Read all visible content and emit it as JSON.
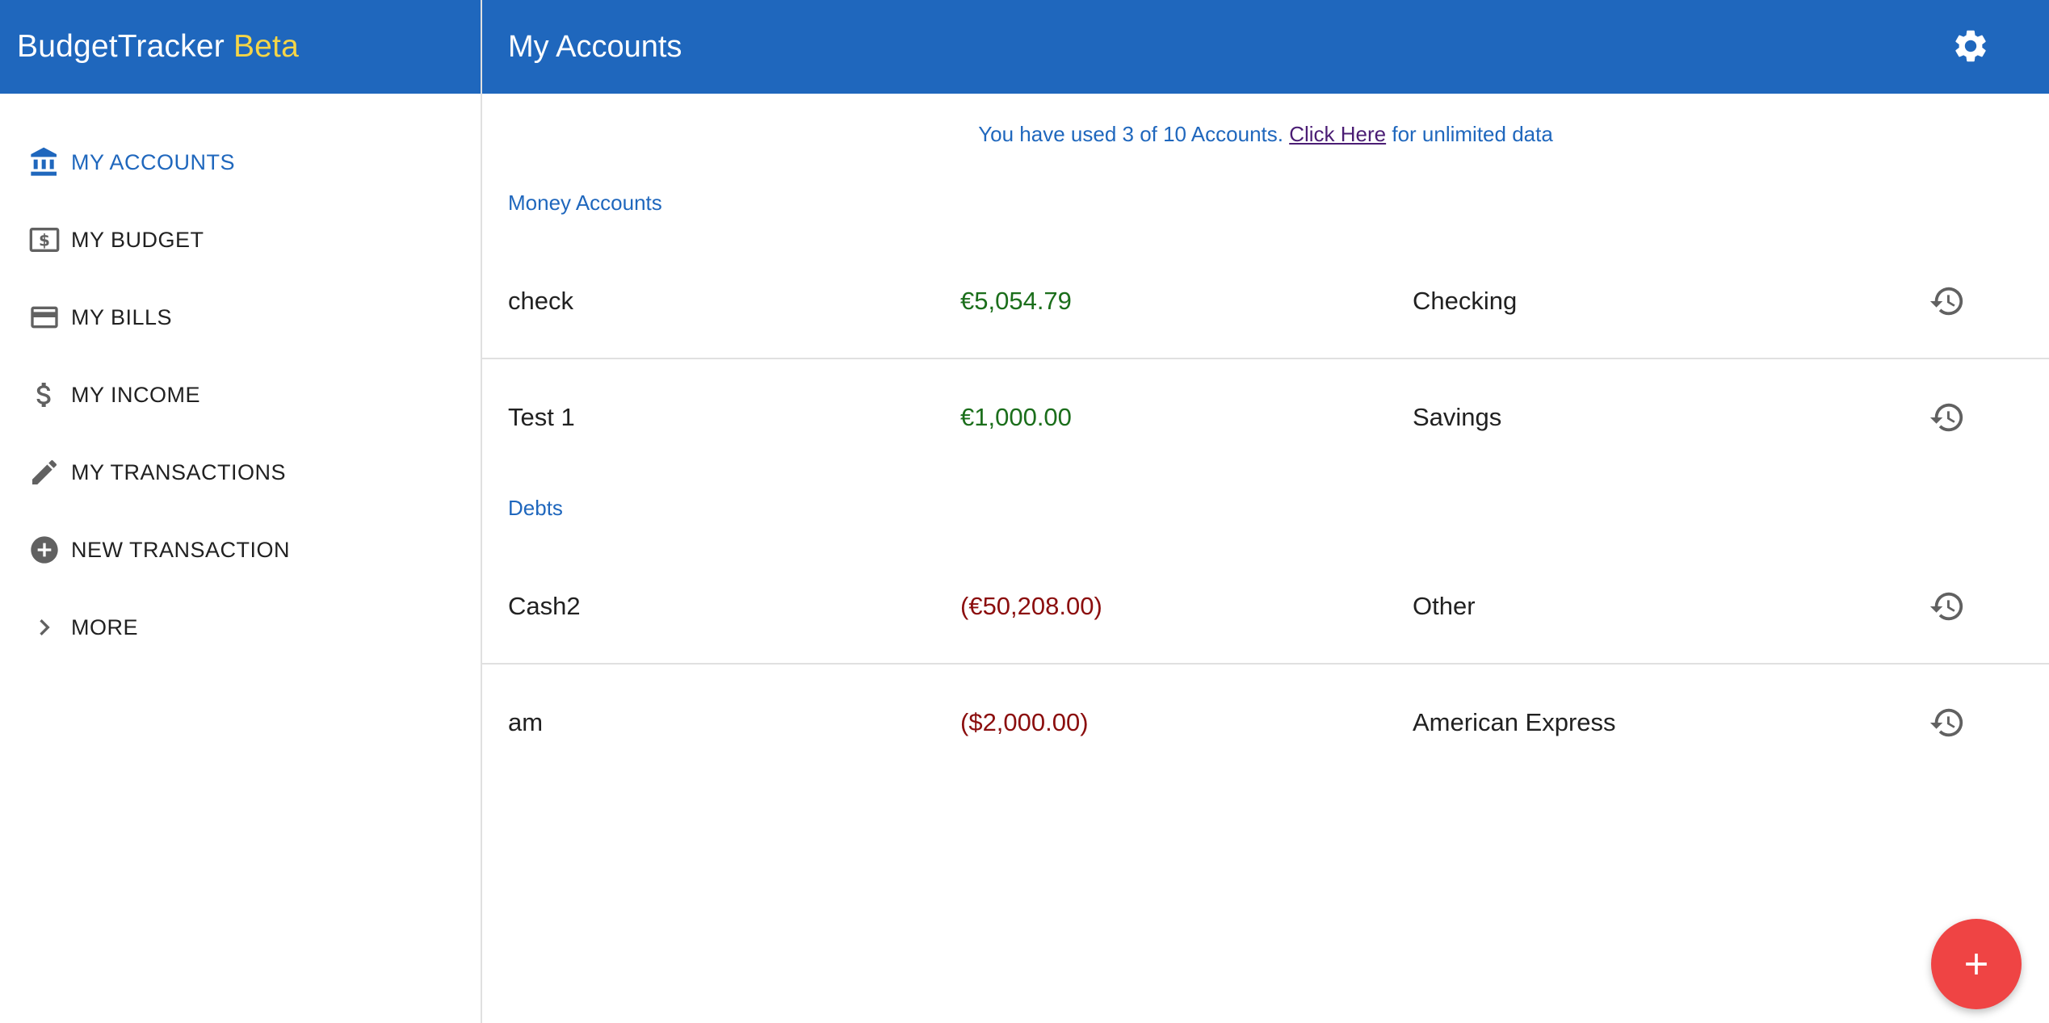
{
  "app": {
    "name": "BudgetTracker",
    "badge": "Beta"
  },
  "header": {
    "title": "My Accounts",
    "settings_icon": "gear-icon"
  },
  "sidebar": {
    "items": [
      {
        "label": "MY ACCOUNTS",
        "icon": "bank-icon",
        "active": true
      },
      {
        "label": "MY BUDGET",
        "icon": "dollar-bill-icon",
        "active": false
      },
      {
        "label": "MY BILLS",
        "icon": "credit-card-icon",
        "active": false
      },
      {
        "label": "MY INCOME",
        "icon": "dollar-sign-icon",
        "active": false
      },
      {
        "label": "MY TRANSACTIONS",
        "icon": "pencil-icon",
        "active": false
      },
      {
        "label": "NEW TRANSACTION",
        "icon": "add-circle-icon",
        "active": false
      },
      {
        "label": "MORE",
        "icon": "chevron-right-icon",
        "active": false
      }
    ]
  },
  "banner": {
    "prefix": "You have used 3 of 10 Accounts. ",
    "link": "Click Here",
    "suffix": " for unlimited data"
  },
  "sections": {
    "money": {
      "title": "Money Accounts",
      "accounts": [
        {
          "name": "check",
          "balance": "€5,054.79",
          "type": "Checking"
        },
        {
          "name": "Test 1",
          "balance": "€1,000.00",
          "type": "Savings"
        }
      ]
    },
    "debts": {
      "title": "Debts",
      "accounts": [
        {
          "name": "Cash2",
          "balance": "(€50,208.00)",
          "type": "Other"
        },
        {
          "name": "am",
          "balance": "($2,000.00)",
          "type": "American Express"
        }
      ]
    }
  },
  "colors": {
    "primary": "#1f67bd",
    "beta": "#f5d547",
    "positive": "#1b6e1b",
    "negative": "#8b0e0e",
    "fab": "#ef4444",
    "icon": "#616161"
  },
  "fab": {
    "icon": "plus-icon"
  }
}
